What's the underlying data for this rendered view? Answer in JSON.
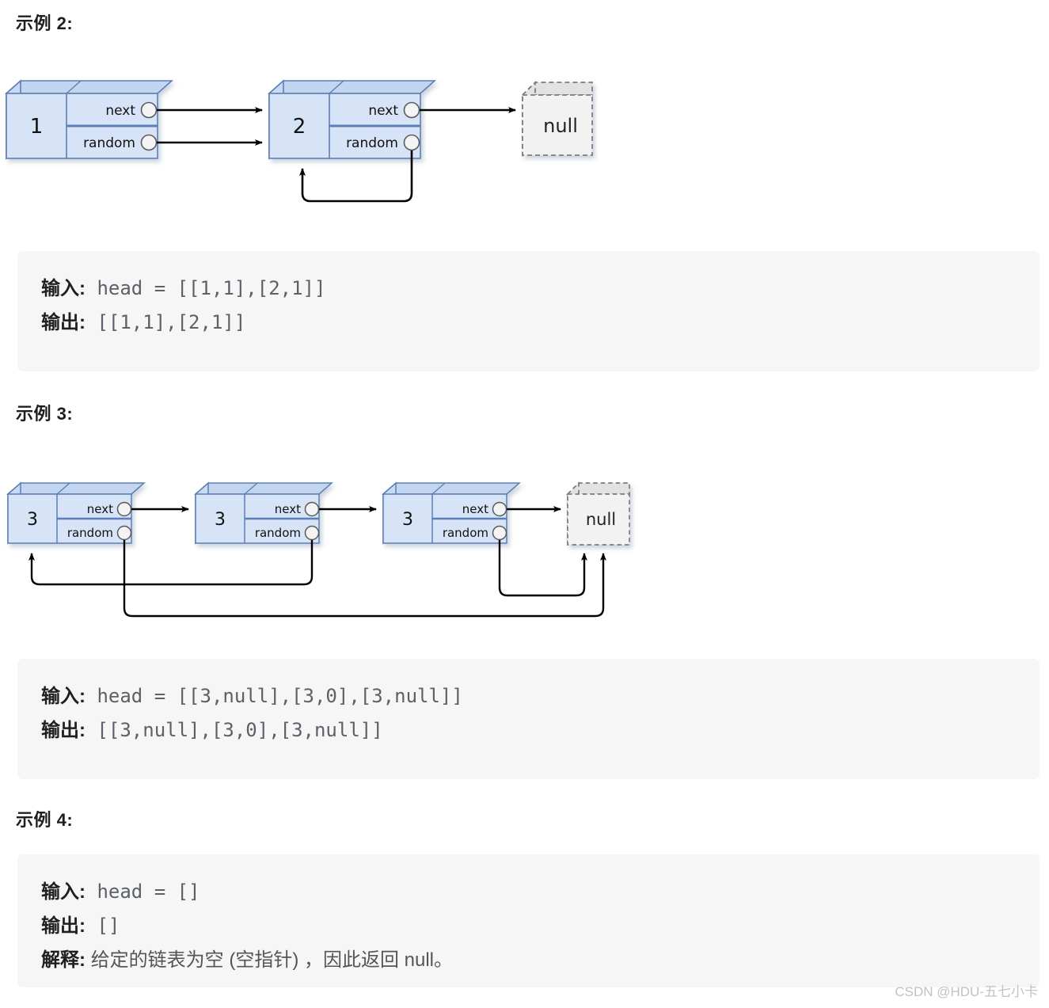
{
  "page": {
    "watermark": "CSDN @HDU-五七小卡"
  },
  "sections": [
    {
      "heading": "示例 2:",
      "diagram": {
        "nodes": [
          {
            "value": "1",
            "next_label": "next",
            "random_label": "random"
          },
          {
            "value": "2",
            "next_label": "next",
            "random_label": "random"
          }
        ],
        "null_label": "null",
        "edges": [
          {
            "from": "node1.next",
            "to": "node2"
          },
          {
            "from": "node1.random",
            "to": "node2"
          },
          {
            "from": "node2.next",
            "to": "null"
          },
          {
            "from": "node2.random",
            "to": "node2"
          }
        ]
      },
      "code": {
        "lines": [
          {
            "label": "输入:",
            "value": " head = [[1,1],[2,1]]"
          },
          {
            "label": "输出:",
            "value": " [[1,1],[2,1]]"
          }
        ]
      }
    },
    {
      "heading": "示例 3:",
      "diagram": {
        "nodes": [
          {
            "value": "3",
            "next_label": "next",
            "random_label": "random"
          },
          {
            "value": "3",
            "next_label": "next",
            "random_label": "random"
          },
          {
            "value": "3",
            "next_label": "next",
            "random_label": "random"
          }
        ],
        "null_label": "null",
        "edges": [
          {
            "from": "node1.next",
            "to": "node2"
          },
          {
            "from": "node2.next",
            "to": "node3"
          },
          {
            "from": "node3.next",
            "to": "null"
          },
          {
            "from": "node1.random",
            "to": "null"
          },
          {
            "from": "node2.random",
            "to": "node1"
          },
          {
            "from": "node3.random",
            "to": "null"
          }
        ]
      },
      "code": {
        "lines": [
          {
            "label": "输入:",
            "value": " head = [[3,null],[3,0],[3,null]]"
          },
          {
            "label": "输出:",
            "value": " [[3,null],[3,0],[3,null]]"
          }
        ]
      }
    },
    {
      "heading": "示例 4:",
      "code": {
        "lines": [
          {
            "label": "输入:",
            "value": " head = []"
          },
          {
            "label": "输出:",
            "value": " []"
          },
          {
            "label": "解释:",
            "value": " 给定的链表为空 (空指针) ，因此返回 null。",
            "is_explanation": true
          }
        ]
      }
    }
  ],
  "colors": {
    "node_fill": "#d7e4f7",
    "node_top": "#c4d6ef",
    "node_side": "#c4d6ef",
    "node_stroke": "#5b7fb5",
    "null_fill": "#f2f2f2",
    "null_stroke": "#808080",
    "code_bg": "#f6f6f6",
    "arrow": "#000000"
  }
}
